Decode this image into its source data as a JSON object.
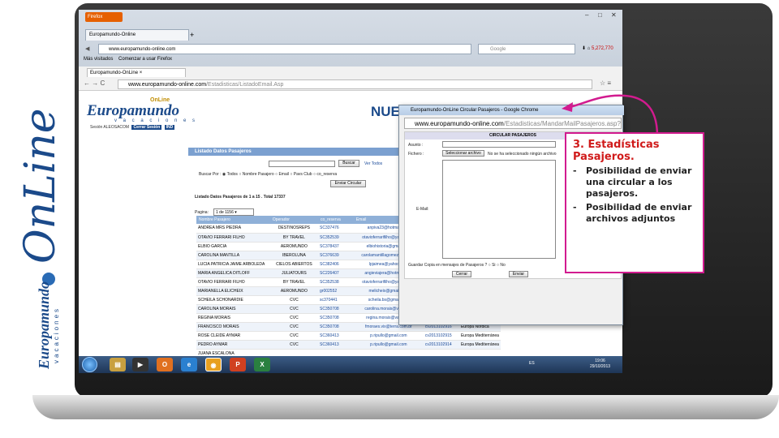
{
  "brand": {
    "online_side": "OnLine",
    "logo_word": "Europamundo",
    "logo_sub": "vacaciones"
  },
  "firefox": {
    "app_button": "Firefox",
    "tab_title": "Europamundo-Online",
    "url": "www.europamundo-online.com",
    "search_placeholder": "Google",
    "bookmark1": "Más visitados",
    "bookmark2": "Comenzar a usar Firefox",
    "counter": "5,272,770"
  },
  "chrome": {
    "tab_title": "Europamundo-OnLine",
    "url_host": "www.europamundo-online.com",
    "url_path": "/Estadisticas/ListadoEmail.Asp"
  },
  "page": {
    "logo_online": "OnLine",
    "logo_main": "Europamundo",
    "logo_vac": "v a c a c i o n e s",
    "sesion_label": "Sesión ALEOSACOM",
    "cerrar_sesion": "Cerrar Sesión",
    "ind": "IND",
    "heading_partial": "NUE",
    "panel_title": "Listado Datos Pasajeros",
    "buscar_btn": "Buscar",
    "ver_todos": "Ver Todos",
    "buscar_por_label": "Buscar Por :",
    "radios": [
      "Todos",
      "Nombre Pasajero",
      "Email",
      "Pavs Club",
      "co_reserva"
    ],
    "enviar_circular": "Enviar Circular",
    "listado_info": "Listado Datos Pasajeros de 1 a 15 . Total 17337",
    "pagina_label": "Pagina:",
    "pagina_value": "1 de 1156",
    "columns": [
      "Nombre Pasajero",
      "Operador",
      "co_reserva",
      "Email",
      "",
      ""
    ],
    "rows": [
      [
        "ANDREA MRS PIEDRA",
        "DESTINOSREPS",
        "SC337476",
        "anpiva23@hotmail.com",
        "",
        ""
      ],
      [
        "OTAVIO FERRARI FILHO",
        "BY TRAVEL",
        "SC352539",
        "otavioferrarifilho@yahoo.com",
        "",
        ""
      ],
      [
        "ELBIO GARCIA",
        "AEROMUNDO",
        "SC378437",
        "elbiohistoria@gmail.com",
        "",
        ""
      ],
      [
        "CAROLINA MANTILLA",
        "IBEROLUNA",
        "SC376639",
        "carolamantillagomez@hotmail",
        "",
        ""
      ],
      [
        "LUCIA PATRICIA JAIME ARBOLEDA",
        "CIELOS ABIERTOS",
        "SC382406",
        "lpjaimea@yahoo.com",
        "",
        ""
      ],
      [
        "MARIA ANGELICA DITLOFF",
        "JULIATOURS",
        "SC226407",
        "angieviajera@hotmail.com",
        "",
        ""
      ],
      [
        "OTAVIO FERRARI FILHO",
        "BY TRAVEL",
        "SC352538",
        "otavioferrarifilho@yahoo.com",
        "",
        ""
      ],
      [
        "MARIANELLA ELICHEIX",
        "AEROMUNDO",
        "gr002552",
        "melicheix@gmail.com",
        "",
        ""
      ],
      [
        "SCHEILA SCHONARDIE",
        "CVC",
        "sc370441",
        "scheila.bs@gmail.com",
        "",
        ""
      ],
      [
        "CAROLINA MORAIS",
        "CVC",
        "SC350708",
        "carolina.morais@vale.com",
        "",
        ""
      ],
      [
        "REGINA MORAIS",
        "CVC",
        "SC350708",
        "regina.morais@vale.com",
        "",
        ""
      ],
      [
        "FRANCISCO MORAIS",
        "CVC",
        "SC350708",
        "fmoraes.vix@terra.com.br",
        "cv2013102916",
        "Europa Nórdica"
      ],
      [
        "ROSE CLEIDE AYMAR",
        "CVC",
        "SC360413",
        "p.ripullo@gmail.com",
        "cv2013102915",
        "Europa Mediterránea"
      ],
      [
        "PEDRO AYMAR",
        "CVC",
        "SC360413",
        "p.ripullo@gmail.com",
        "cv2013102914",
        "Europa Mediterránea"
      ],
      [
        "JUANA ESCALONA",
        "",
        "",
        "",
        "",
        ""
      ]
    ]
  },
  "popup": {
    "title": "Europamundo-OnLine Circular Pasajeros - Google Chrome",
    "url_host": "www.europamundo-online.com",
    "url_path": "/Estadisticas/MandarMailPasajeros.asp?Estad",
    "form_title": "CIRCULAR PASAJEROS",
    "asunto_label": "Asunto :",
    "fichero_label": "Fichero :",
    "file_button": "Seleccionar archivo",
    "file_status": "No se ha seleccionado ningún archivo",
    "email_label": "E-Mail:",
    "guardar_label": "Guardar Copia en mensajes de Pasajeros ?",
    "si": "Si",
    "no": "No",
    "cerrar": "Cerrar",
    "enviar": "Enviar"
  },
  "taskbar": {
    "lang": "ES",
    "time": "19:06",
    "date": "29/10/2013"
  },
  "callout": {
    "title": "3. Estadísticas Pasajeros.",
    "items": [
      "Posibilidad de enviar una circular a los pasajeros.",
      "Posibilidad de enviar archivos adjuntos"
    ]
  },
  "colors": {
    "callout_border": "#d21b8f",
    "callout_title": "#d01b1b",
    "brand_blue": "#1b4a8a"
  }
}
